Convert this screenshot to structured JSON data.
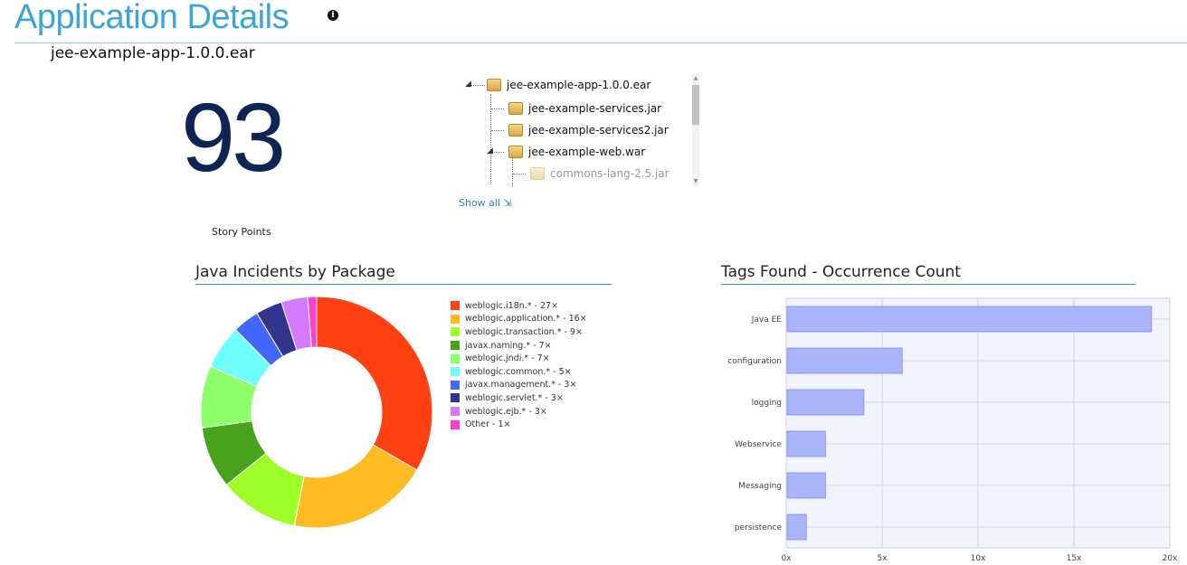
{
  "header": {
    "title": "Application Details",
    "subtitle": "jee-example-app-1.0.0.ear"
  },
  "story_points": {
    "value": "93",
    "label": "Story Points"
  },
  "tree": {
    "nodes": [
      {
        "label": "jee-example-app-1.0.0.ear",
        "level": 0,
        "expanded": true
      },
      {
        "label": "jee-example-services.jar",
        "level": 1
      },
      {
        "label": "jee-example-services2.jar",
        "level": 1
      },
      {
        "label": "jee-example-web.war",
        "level": 1,
        "expanded": true
      },
      {
        "label": "commons-lang-2.5.jar",
        "level": 2
      }
    ],
    "show_all": "Show all ⇲"
  },
  "incidents": {
    "title": "Java Incidents by Package"
  },
  "tags": {
    "title": "Tags Found - Occurrence Count"
  },
  "chart_data": [
    {
      "type": "pie",
      "title": "Java Incidents by Package",
      "categories": [
        "weblogic.i18n.*",
        "weblogic.application.*",
        "weblogic.transaction.*",
        "javax.naming.*",
        "weblogic.jndi.*",
        "weblogic.common.*",
        "javax.management.*",
        "weblogic.servlet.*",
        "weblogic.ejb.*",
        "Other"
      ],
      "values": [
        27,
        16,
        9,
        7,
        7,
        5,
        3,
        3,
        3,
        1
      ],
      "legend_labels": [
        "weblogic.i18n.* - 27×",
        "weblogic.application.* - 16×",
        "weblogic.transaction.* - 9×",
        "javax.naming.* - 7×",
        "weblogic.jndi.* - 7×",
        "weblogic.common.* - 5×",
        "javax.management.* - 3×",
        "weblogic.servlet.* - 3×",
        "weblogic.ejb.* - 3×",
        "Other - 1×"
      ],
      "colors": [
        "#ff4012",
        "#ffbb22",
        "#9eff26",
        "#46a31a",
        "#8dff6a",
        "#70ffff",
        "#4267ff",
        "#32358e",
        "#d57aff",
        "#ff3ed0"
      ],
      "legend": "right"
    },
    {
      "type": "bar",
      "orientation": "horizontal",
      "title": "Tags Found - Occurrence Count",
      "categories": [
        "Java EE",
        "configuration",
        "logging",
        "Webservice",
        "Messaging",
        "persistence"
      ],
      "values": [
        19,
        6,
        4,
        2,
        2,
        1
      ],
      "xlim": [
        0,
        20
      ],
      "xticks": [
        "0x",
        "5x",
        "10x",
        "15x",
        "20x"
      ],
      "grid": true,
      "bar_color": "#aab4fa",
      "bar_border": "#8c96f2",
      "background": "#f1f5fb"
    }
  ]
}
